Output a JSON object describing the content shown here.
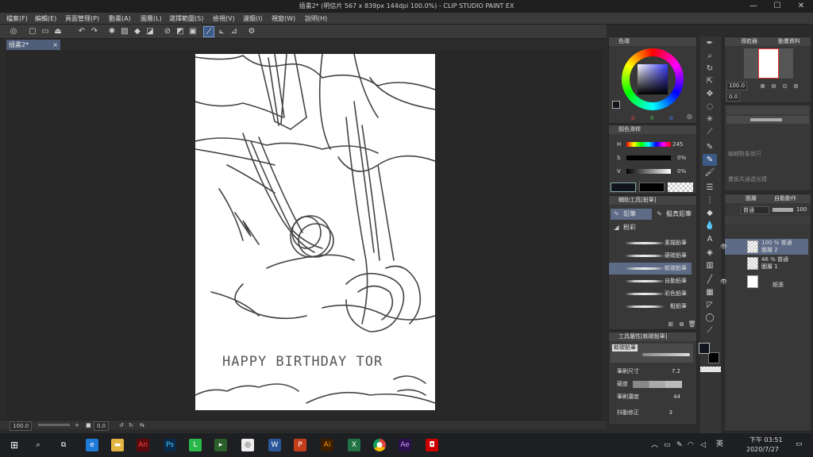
{
  "window": {
    "title": "插畫2* (明信片 567 x 839px 144dpi 100.0%) - CLIP STUDIO PAINT EX",
    "min": "—",
    "max": "☐",
    "close": "✕"
  },
  "menu": [
    "檔案(F)",
    "編輯(E)",
    "頁面管理(P)",
    "動畫(A)",
    "圖層(L)",
    "選擇範圍(S)",
    "檢視(V)",
    "濾鏡(I)",
    "視窗(W)",
    "說明(H)"
  ],
  "tab": {
    "label": "插畫2*",
    "close": "×"
  },
  "canvas_text": "HAPPY BIRTHDAY TOR",
  "status": {
    "zoom": "100.0",
    "angle": "0.0"
  },
  "color_panel": {
    "title": "色環",
    "values": [
      "0",
      "0",
      "0"
    ]
  },
  "slider_panel": {
    "title": "顏色滑桿",
    "rows": [
      {
        "label": "H",
        "value": "245"
      },
      {
        "label": "S",
        "value": "0%"
      },
      {
        "label": "V",
        "value": "0%"
      }
    ]
  },
  "subtool_panel": {
    "title": "輔助工具[鉛筆]",
    "tabs": [
      "鉛筆",
      "擬真鉛筆",
      "粉彩"
    ],
    "brushes": [
      "素描鉛筆",
      "硬碳鉛筆",
      "軟碳鉛筆",
      "自動鉛筆",
      "彩色鉛筆",
      "粗鉛筆"
    ]
  },
  "tool_property": {
    "title": "工具屬性[軟碳鉛筆]",
    "brush_name": "軟碳鉛筆",
    "rows": [
      {
        "label": "筆刷尺寸",
        "value": "7.2"
      },
      {
        "label": "硬度",
        "value": ""
      },
      {
        "label": "筆刷濃度",
        "value": "44"
      },
      {
        "label": "抖動修正",
        "value": "3"
      }
    ]
  },
  "navigator": {
    "title": "導航器",
    "tab2": "動畫資料",
    "zoom": "100.0",
    "angle": "0.0"
  },
  "subview": {
    "note1": "編輯對象就只",
    "note2": "畫板共通透光模"
  },
  "layer_panel": {
    "title": "圖層",
    "tab2": "自動動作",
    "blend": "普通",
    "opacity": "100",
    "layers": [
      {
        "line1": "100 % 普通",
        "line2": "圖層 2"
      },
      {
        "line1": "46 % 普通",
        "line2": "圖層 1"
      },
      {
        "line1": "",
        "line2": "紙張"
      }
    ]
  },
  "taskbar": {
    "ime": "英",
    "time": "下午 03:51",
    "date": "2020/7/27"
  },
  "colors": {
    "accent": "#3c5a86",
    "bg": "#2b2b2b",
    "panel": "#383838"
  }
}
